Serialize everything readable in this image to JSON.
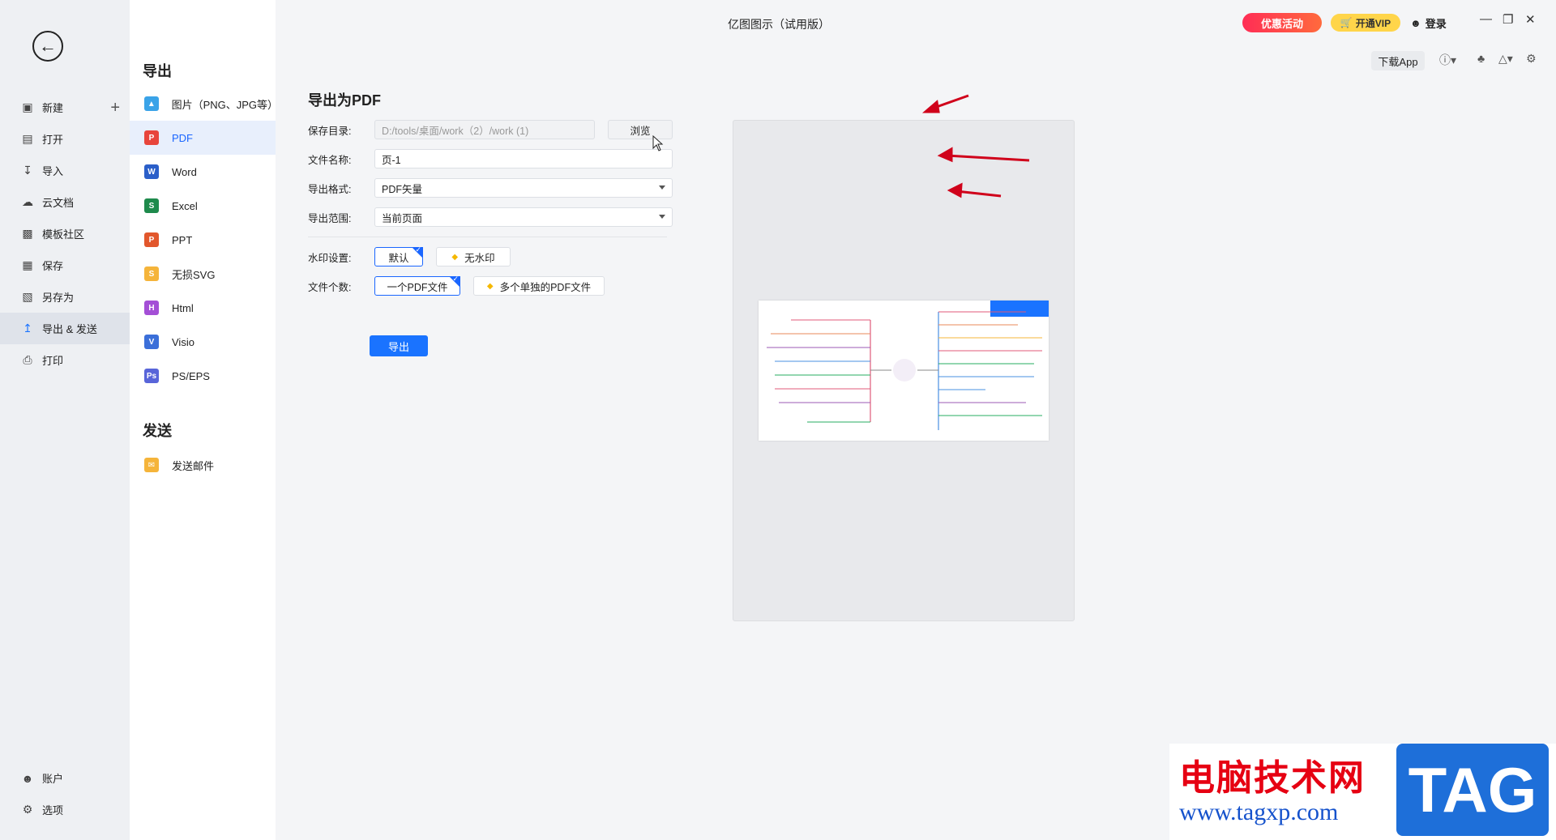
{
  "window": {
    "title": "亿图图示（试用版）",
    "promo_label": "优惠活动",
    "vip_label": "开通VIP",
    "login_label": "登录",
    "download_app": "下载App"
  },
  "nav": {
    "items": [
      {
        "label": "新建",
        "icon": "new-file-icon"
      },
      {
        "label": "打开",
        "icon": "folder-icon"
      },
      {
        "label": "导入",
        "icon": "import-icon"
      },
      {
        "label": "云文档",
        "icon": "cloud-icon"
      },
      {
        "label": "模板社区",
        "icon": "community-icon"
      },
      {
        "label": "保存",
        "icon": "save-icon"
      },
      {
        "label": "另存为",
        "icon": "save-as-icon"
      },
      {
        "label": "导出 & 发送",
        "icon": "export-icon"
      },
      {
        "label": "打印",
        "icon": "print-icon"
      }
    ],
    "bottom": [
      {
        "label": "账户",
        "icon": "user-icon"
      },
      {
        "label": "选项",
        "icon": "gear-icon"
      }
    ]
  },
  "formats": {
    "export_title": "导出",
    "send_title": "发送",
    "items": [
      {
        "label": "图片（PNG、JPG等）",
        "color": "#3aa3e8"
      },
      {
        "label": "PDF",
        "color": "#e8453c"
      },
      {
        "label": "Word",
        "color": "#2b5fc9"
      },
      {
        "label": "Excel",
        "color": "#1e8a4c"
      },
      {
        "label": "PPT",
        "color": "#e2572c"
      },
      {
        "label": "无损SVG",
        "color": "#f5b43a"
      },
      {
        "label": "Html",
        "color": "#a44fd6"
      },
      {
        "label": "Visio",
        "color": "#3b6fd9"
      },
      {
        "label": "PS/EPS",
        "color": "#5865d9"
      }
    ],
    "send_items": [
      {
        "label": "发送邮件",
        "color": "#f5b43a"
      }
    ]
  },
  "panel": {
    "title": "导出为PDF",
    "save_dir_label": "保存目录:",
    "save_dir_value": "D:/tools/桌面/work（2）/work (1)",
    "browse_label": "浏览",
    "filename_label": "文件名称:",
    "filename_value": "页-1",
    "format_label": "导出格式:",
    "format_value": "PDF矢量",
    "range_label": "导出范围:",
    "range_value": "当前页面",
    "watermark_label": "水印设置:",
    "watermark_default": "默认",
    "watermark_none": "无水印",
    "filecount_label": "文件个数:",
    "filecount_single": "一个PDF文件",
    "filecount_multi": "多个单独的PDF文件",
    "export_button": "导出"
  },
  "colors": {
    "accent": "#1a73ff",
    "arrow": "#d0021b"
  },
  "site_watermark": {
    "cn": "电脑技术网",
    "url": "www.tagxp.com",
    "tag": "TAG"
  }
}
